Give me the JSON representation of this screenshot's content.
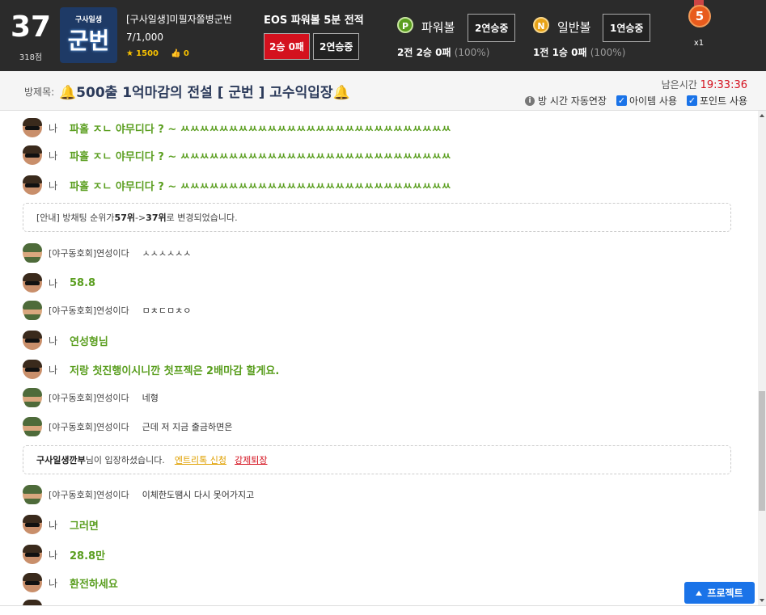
{
  "header": {
    "rank": "37",
    "score": "318점",
    "logo_small": "구사일생",
    "logo_big": "군번",
    "room_name": "[구사일생]미필자쫄병군번",
    "member_count": "7/1,000",
    "stars": "1500",
    "likes": "0",
    "eos_title": "EOS 파워볼 5분 전적",
    "eos_record": "2승 0패",
    "eos_streak": "2연승중",
    "powerball": {
      "icon": "P",
      "name": "파워볼",
      "streak": "2연승중",
      "record": "2전 2승 0패",
      "pct": "(100%)",
      "color": "#5a9e1f"
    },
    "normalball": {
      "icon": "N",
      "name": "일반볼",
      "streak": "1연승중",
      "record": "1전 1승 0패",
      "pct": "(100%)",
      "color": "#e8a317"
    },
    "medal_level": "5",
    "medal_mult": "x1"
  },
  "titlebar": {
    "label": "방제목:",
    "bell": "🔔",
    "title": "500출 1억마감의 전설 [ 군번 ] 고수익입장",
    "timer_label": "남은시간",
    "timer_value": "19:33:36",
    "opt_auto": "방 시간 자동연장",
    "opt_item": "아이템 사용",
    "opt_point": "포인트 사용"
  },
  "chat": {
    "me_label": "나",
    "msgs": [
      {
        "type": "me",
        "text": "파홀 ㅈㄴ 야무디다 ? ~ ㅆㅆㅆㅆㅆㅆㅆㅆㅆㅆㅆㅆㅆㅆㅆㅆㅆㅆㅆㅆㅆㅆㅆㅆㅆㅆㅆㅆ"
      },
      {
        "type": "me",
        "text": "파홀 ㅈㄴ 야무디다 ? ~ ㅆㅆㅆㅆㅆㅆㅆㅆㅆㅆㅆㅆㅆㅆㅆㅆㅆㅆㅆㅆㅆㅆㅆㅆㅆㅆㅆㅆ"
      },
      {
        "type": "me",
        "text": "파홀 ㅈㄴ 야무디다 ? ~ ㅆㅆㅆㅆㅆㅆㅆㅆㅆㅆㅆㅆㅆㅆㅆㅆㅆㅆㅆㅆㅆㅆㅆㅆㅆㅆㅆㅆ"
      },
      {
        "type": "other",
        "name": "[야구동호회]연성이다",
        "text": "ㅅㅅㅅㅅㅅㅅ"
      },
      {
        "type": "me",
        "text": "58.8"
      },
      {
        "type": "other",
        "name": "[야구동호회]연성이다",
        "text": "ㅁㅊㄷㅁㅊㅇ"
      },
      {
        "type": "me",
        "text": "연성형님"
      },
      {
        "type": "me",
        "text": "저랑 첫진행이시니깐 첫프젝은 2배마감 할게요."
      },
      {
        "type": "other",
        "name": "[야구동호회]연성이다",
        "text": "네형"
      },
      {
        "type": "other",
        "name": "[야구동호회]연성이다",
        "text": "근데 저 지금 출금하면은"
      },
      {
        "type": "other",
        "name": "[야구동호회]연성이다",
        "text": "이체한도땜시 다시 못어가지고"
      },
      {
        "type": "me",
        "text": "그러면"
      },
      {
        "type": "me",
        "text": "28.8만"
      },
      {
        "type": "me",
        "text": "환전하세요"
      }
    ],
    "notice1": {
      "prefix": "[안내] 방채팅 순위가 ",
      "from": "57위",
      "arrow": " -> ",
      "to": "37위",
      "suffix": " 로 변경되었습니다."
    },
    "notice2": {
      "user": "구사일생깐부",
      "suffix": "님이 입장하셨습니다.",
      "link1": "엔트리톡 신청",
      "link2": "강제퇴장"
    }
  },
  "protect_label": "프로젝트"
}
